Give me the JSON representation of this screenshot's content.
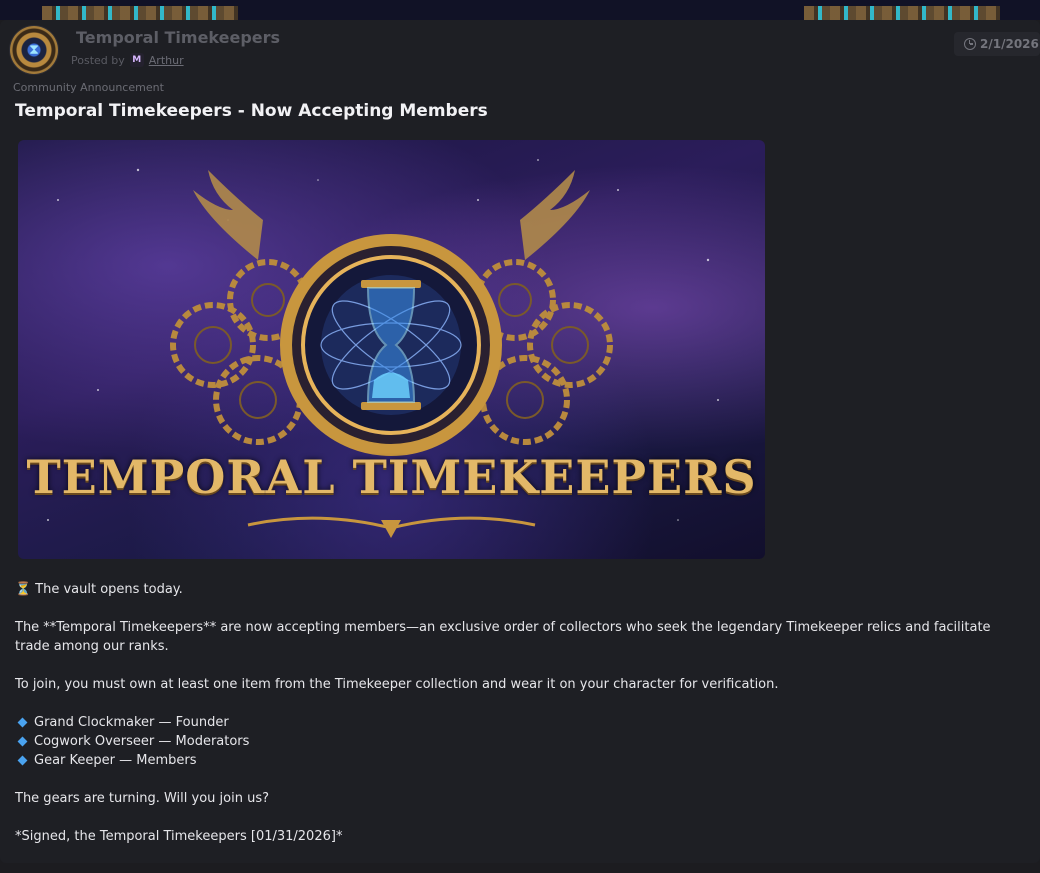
{
  "post": {
    "guild_name": "Temporal Timekeepers",
    "posted_by_label": "Posted by",
    "author_badge": "M",
    "author": "Arthur",
    "date": "2/1/2026",
    "category": "Community Announcement",
    "title": "Temporal Timekeepers - Now Accepting Members",
    "banner_text": "TEMPORAL TIMEKEEPERS"
  },
  "body": {
    "line1": "The vault opens today.",
    "line1_icon": "⏳",
    "para1": "The **Temporal Timekeepers** are now accepting members—an exclusive order of collectors who seek the legendary Timekeeper relics and facilitate trade among our ranks.",
    "para2": "To join, you must own at least one item from the Timekeeper collection and wear it on your character for verification.",
    "ranks": [
      {
        "label": "Grand Clockmaker — Founder"
      },
      {
        "label": "Cogwork Overseer — Moderators"
      },
      {
        "label": "Gear Keeper — Members"
      }
    ],
    "para3": "The gears are turning. Will you join us?",
    "signature": "*Signed, the Temporal Timekeepers [01/31/2026]*"
  },
  "icons": {
    "clock": "clock-icon",
    "rank_bullet": "diamond-icon",
    "hourglass": "hourglass-icon"
  },
  "colors": {
    "background": "#1e1f24",
    "accent_blue": "#4aa3f0",
    "gold": "#e3b868"
  }
}
